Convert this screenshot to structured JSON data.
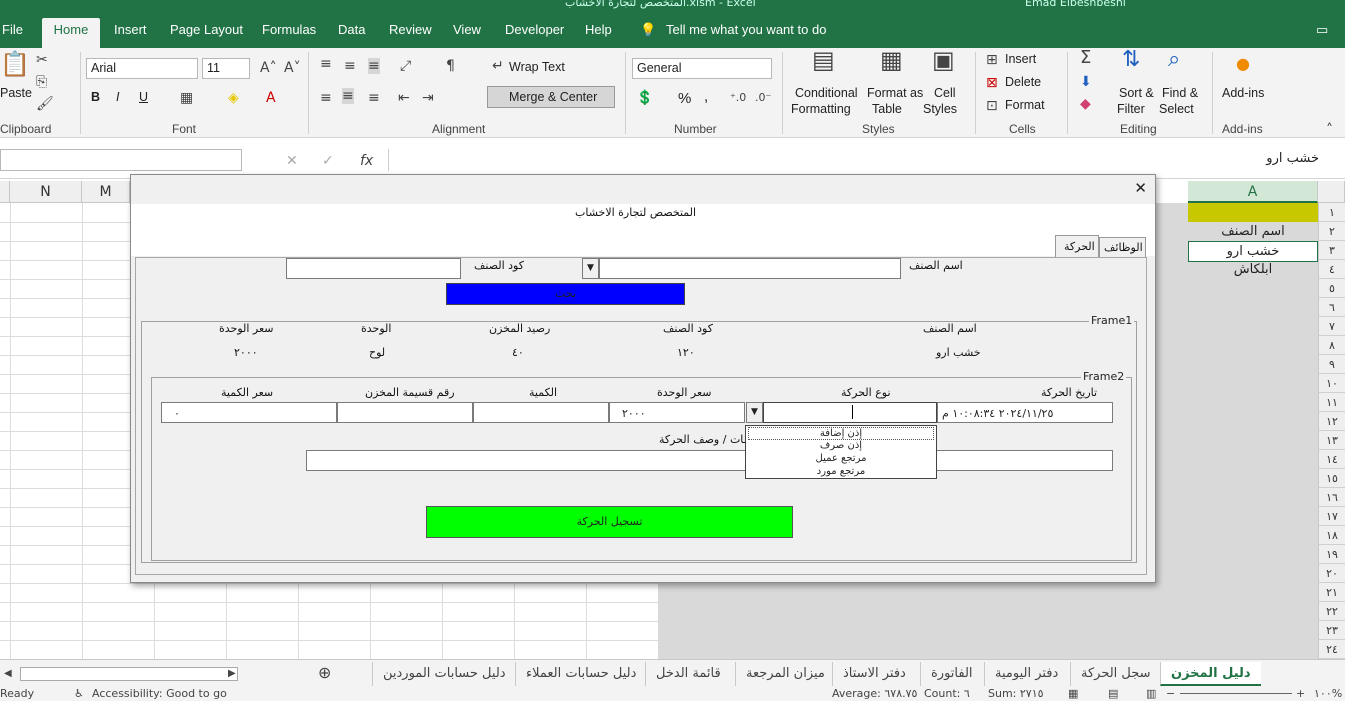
{
  "window": {
    "title": "المتخصص لتجارة الاخشاب.xlsm - Excel",
    "user": "Emad Elbeshbeshi"
  },
  "ribbon_tabs": [
    "File",
    "Home",
    "Insert",
    "Page Layout",
    "Formulas",
    "Data",
    "Review",
    "View",
    "Developer",
    "Help"
  ],
  "tell_me": "Tell me what you want to do",
  "ribbon": {
    "clipboard": {
      "paste": "Paste",
      "label": "Clipboard"
    },
    "font": {
      "name": "Arial",
      "size": "11",
      "label": "Font",
      "bold": "B",
      "italic": "I",
      "underline": "U"
    },
    "alignment": {
      "wrap": "Wrap Text",
      "merge": "Merge & Center",
      "label": "Alignment"
    },
    "number": {
      "format": "General",
      "label": "Number",
      "percent": "%",
      "comma": ","
    },
    "styles": {
      "cond1": "Conditional",
      "cond2": "Formatting",
      "fmt1": "Format as",
      "fmt2": "Table",
      "cell1": "Cell",
      "cell2": "Styles",
      "label": "Styles"
    },
    "cells": {
      "insert": "Insert",
      "delete": "Delete",
      "format": "Format",
      "label": "Cells"
    },
    "editing": {
      "sort1": "Sort &",
      "sort2": "Filter",
      "find1": "Find &",
      "find2": "Select",
      "label": "Editing"
    },
    "addins": {
      "btn": "Add-ins",
      "label": "Add-ins"
    }
  },
  "formula_bar": {
    "fx": "fx",
    "value": "خشب ارو"
  },
  "columns": {
    "n": "N",
    "m": "M",
    "a": "A"
  },
  "rows": [
    "١",
    "٢",
    "٣",
    "٤",
    "٥",
    "٦",
    "٧",
    "٨",
    "٩",
    "١٠",
    "١١",
    "١٢",
    "١٣",
    "١٤",
    "١٥",
    "١٦",
    "١٧",
    "١٨",
    "١٩",
    "٢٠",
    "٢١",
    "٢٢",
    "٢٣",
    "٢٤"
  ],
  "cells": {
    "a2": "اسم الصنف",
    "a3": "خشب ارو",
    "a4": "ابلكاش"
  },
  "dialog": {
    "close": "✕",
    "title": "المتخصص لتجارة الاخشاب",
    "tabs": [
      "الوظائف",
      "الحركة"
    ],
    "item_name_label": "اسم الصنف",
    "item_code_label": "كود الصنف",
    "blue_button": "بحث",
    "frame1": {
      "title": "Frame1",
      "headers": [
        "اسم الصنف",
        "كود الصنف",
        "رصيد المخزن",
        "الوحدة",
        "سعر الوحدة"
      ],
      "values": [
        "خشب ارو",
        "١٢٠",
        "٤٠",
        "لوح",
        "٢٠٠٠"
      ]
    },
    "frame2": {
      "title": "Frame2",
      "headers": [
        "تاريخ الحركة",
        "نوع الحركة",
        "سعر الوحدة",
        "الكمية",
        "رقم قسيمة المخزن",
        "سعر الكمية"
      ],
      "date_value": "٢٠٢٤/١١/٢٥ ١٠:٠٨:٣٤ م",
      "unit_price_value": "٢٠٠٠",
      "qty_price_value": "٠",
      "notes_label": "ملاحظات / وصف الحركة",
      "dropdown_options": [
        "إذن إضافة",
        "إذن صرف",
        "مرتجع عميل",
        "مرتجع مورد"
      ],
      "submit": "تسجيل الحركة"
    }
  },
  "sheet_tabs": [
    "دليل المخزن",
    "سجل الحركة",
    "دفتر اليومية",
    "الفاتورة",
    "دفتر الاستاذ",
    "ميزان المرجعة",
    "قائمة الدخل",
    "دليل حسابات العملاء",
    "دليل حسابات الموردين"
  ],
  "status": {
    "ready": "Ready",
    "accessibility": "Accessibility: Good to go",
    "average": "Average: ٦٧٨.٧٥",
    "count": "Count: ٦",
    "sum": "Sum: ٢٧١٥",
    "zoom": "١٠٠%"
  },
  "colors": {
    "excel_green": "#217346",
    "blue_button": "#0000ff",
    "green_button": "#00ff00",
    "header_yellow": "#c8c800"
  }
}
